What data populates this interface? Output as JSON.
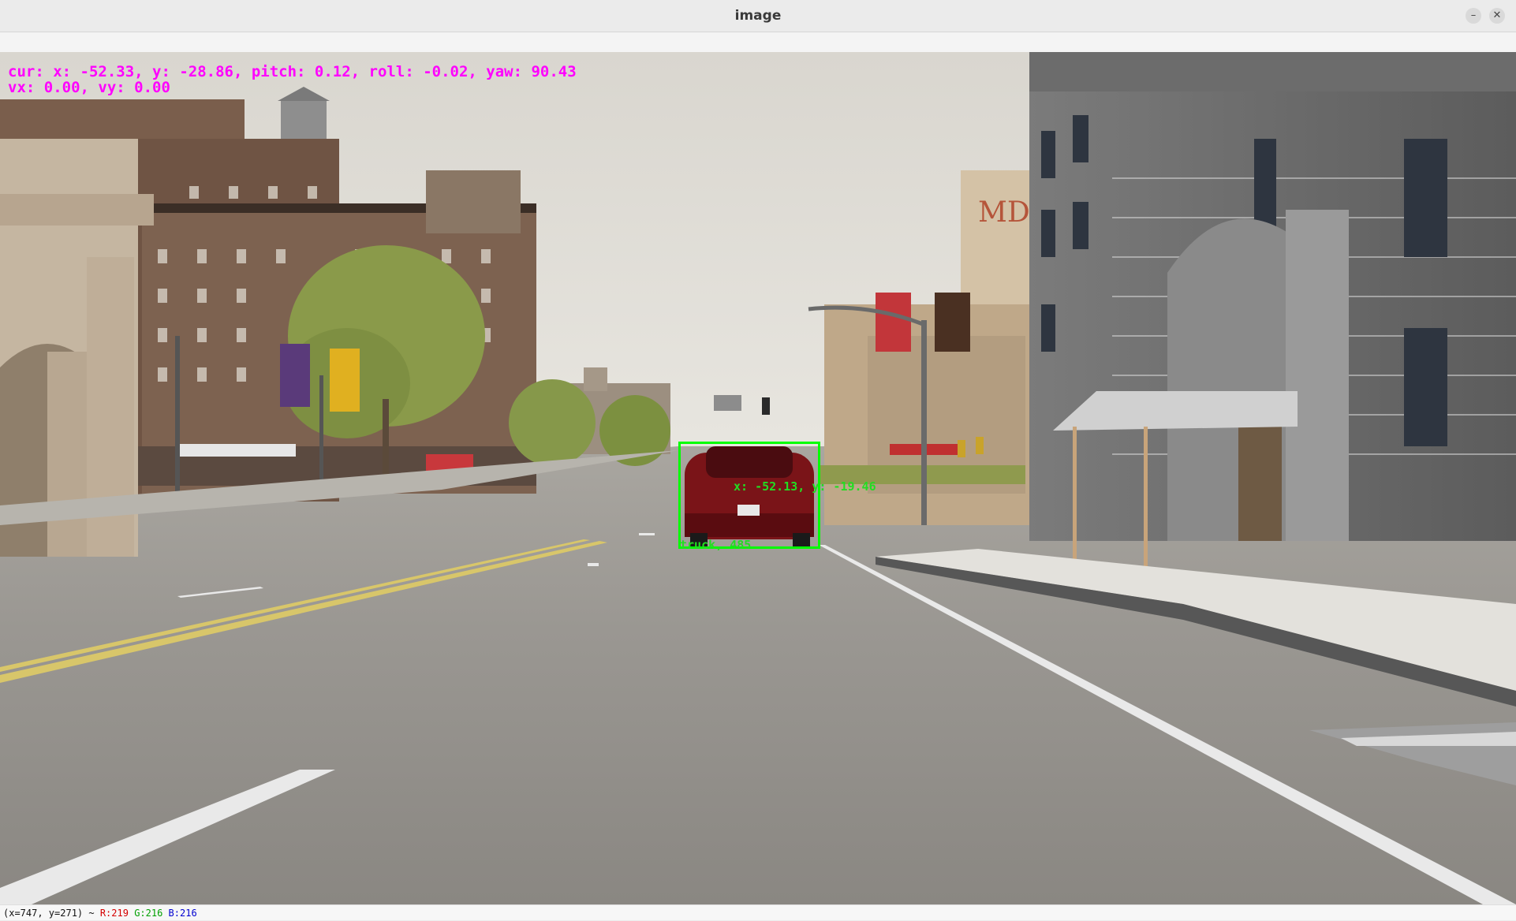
{
  "window": {
    "title": "image",
    "minimize_glyph": "–",
    "close_glyph": "✕"
  },
  "hud": {
    "line1": "cur: x: -52.33, y: -28.86, pitch: 0.12, roll: -0.02, yaw: 90.43",
    "line2": "vx: 0.00, vy: 0.00",
    "color": "#ff00ff"
  },
  "detection": {
    "position_label": "x: -52.13, y: -19.46",
    "class_label": "truck, 485",
    "color": "#00ff00"
  },
  "statusbar": {
    "coords": "(x=747, y=271) ~ ",
    "r": "R:219",
    "g": "G:216",
    "b": "B:216"
  },
  "scene": {
    "billboard_text": "MD"
  }
}
